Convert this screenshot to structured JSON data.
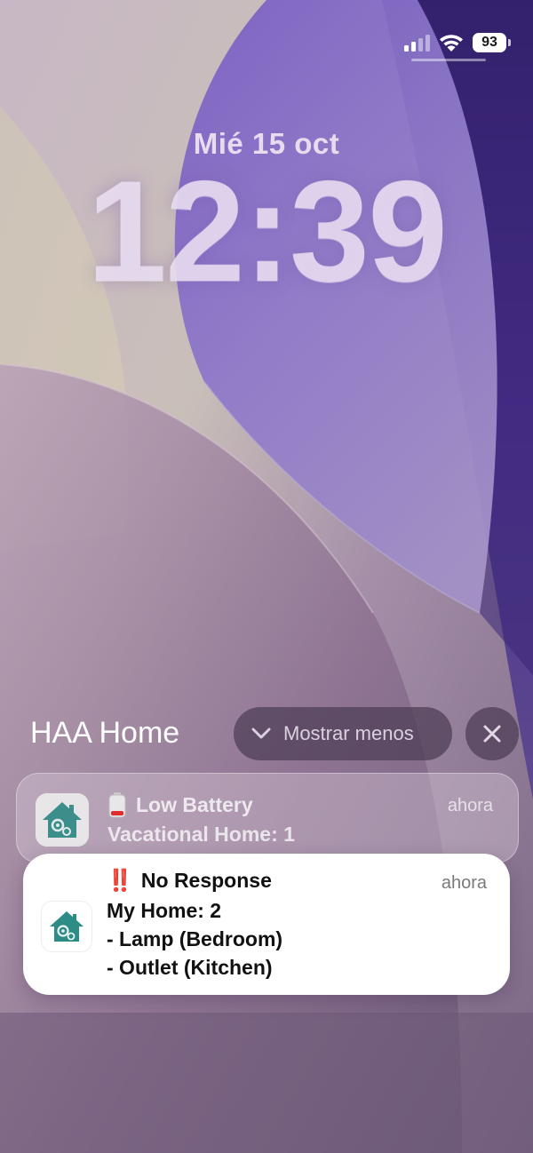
{
  "status_bar": {
    "battery_level": "93",
    "signal_bars_active": 2,
    "signal_bars_total": 4
  },
  "lock_screen": {
    "date": "Mié 15 oct",
    "time": "12:39"
  },
  "group": {
    "app_name": "HAA Home",
    "show_less_label": "Mostrar menos",
    "chevron_icon": "chevron-down-icon",
    "close_icon": "close-icon"
  },
  "notifications": [
    {
      "app_icon": "haa-home-app-icon",
      "emoji_icon": "low-battery-icon",
      "title": "Low Battery",
      "time": "ahora",
      "body": [
        "Vacational Home: 1"
      ]
    },
    {
      "app_icon": "haa-home-app-icon",
      "emoji_icon": "double-exclamation-icon",
      "emoji": "‼️",
      "title": "No Response",
      "time": "ahora",
      "body": [
        "My Home: 2",
        "- Lamp (Bedroom)",
        "- Outlet (Kitchen)"
      ]
    }
  ],
  "colors": {
    "accent_red": "#e0211a",
    "app_icon_teal": "#2e8c86",
    "card_background": "#ffffff"
  }
}
